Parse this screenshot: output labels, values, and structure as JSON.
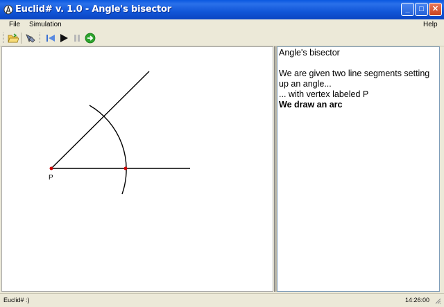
{
  "window": {
    "title": "Euclid# v. 1.0 - Angle's bisector",
    "controls": {
      "minimize": "_",
      "maximize": "□",
      "close": "✕"
    }
  },
  "menubar": {
    "file": "File",
    "simulation": "Simulation",
    "help": "Help"
  },
  "toolbar": {
    "icons": [
      "open-folder-icon",
      "settings-icon",
      "step-back-icon",
      "play-icon",
      "pause-icon",
      "next-icon"
    ],
    "next_color": "#2da32d"
  },
  "canvas": {
    "vertex_label": "P",
    "point_color": "#cc0000"
  },
  "panel": {
    "title": "Angle's bisector",
    "lines": [
      "We are given two line segments setting",
      "up an angle...",
      "... with vertex labeled P"
    ],
    "current_step": "We draw an arc"
  },
  "status": {
    "left": "Euclid# :)",
    "time": "14:26:00"
  }
}
